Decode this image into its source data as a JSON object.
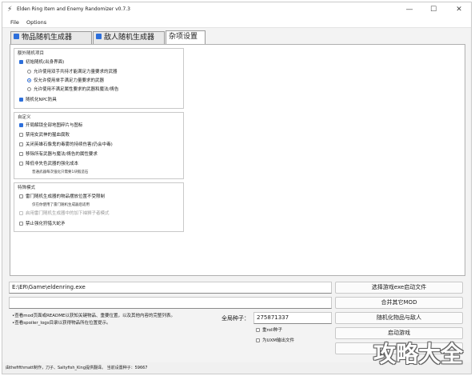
{
  "window": {
    "title": "Elden Ring Item and Enemy Randomizer v0.7.3",
    "minimize": "—",
    "maximize": "☐",
    "close": "✕"
  },
  "menu": {
    "file": "File",
    "options": "Options"
  },
  "tabs": [
    {
      "label": "物品随机生成器",
      "checked": true
    },
    {
      "label": "敌人随机生成器",
      "checked": true
    },
    {
      "label": "杂项设置",
      "active": true
    }
  ],
  "groups": {
    "extra": {
      "title": "额外随机项目",
      "items": [
        {
          "label": "初始随机(出身界面)",
          "type": "checkbox",
          "checked": true
        },
        {
          "label": "允许使用双手共持才能满足力量要求的武器",
          "type": "radio",
          "checked": false
        },
        {
          "label": "仅允许使用单手满足力量要求的武器",
          "type": "radio",
          "checked": true
        },
        {
          "label": "允许使用不满足属性要求的武器和魔法/祷告",
          "type": "radio",
          "checked": false
        },
        {
          "label": "随机化NPC防具",
          "type": "checkbox",
          "checked": true
        }
      ]
    },
    "custom": {
      "title": "自定义",
      "items": [
        {
          "label": "开局解锁全部地图碎片与图标",
          "checked": true
        },
        {
          "label": "禁用女武神的猩血腐败",
          "checked": false
        },
        {
          "label": "关闭英雄石像鬼的毒雾的持续伤害(仍会中毒)",
          "checked": false
        },
        {
          "label": "移除所有武器与魔法/祷告的属性要求",
          "checked": false
        },
        {
          "label": "降低非失色武器的强化成本",
          "checked": false
        }
      ],
      "note": "普通武器每次强化只需要1块锻造石"
    },
    "special": {
      "title": "特殊模式",
      "items": [
        {
          "label": "雷门随机生成器的物品摆放位置不受限制",
          "checked": false,
          "disabled": false
        },
        {
          "label": "启用雷门随机生成器中的加下袖狮子者模式",
          "checked": false,
          "disabled": true
        },
        {
          "label": "禁止强化狩猎大蛇矛",
          "checked": false,
          "disabled": false
        }
      ],
      "note": "仅在你使用了雷门随机生成器后适用"
    }
  },
  "path": {
    "value": "E:\\ER\\Game\\eldenring.exe"
  },
  "buttons": {
    "select_exe": "选择游戏exe启动文件",
    "merge_mod": "合并其它MOD",
    "randomize": "随机化物品与敌人",
    "launch": "启动游戏"
  },
  "info": {
    "line1": "•查看mod页面或README以获知关键物品、重要位置，以及其他内容的完整列表。",
    "line2": "•查看spoiler_logs目录以获得物品所在位置提示。"
  },
  "seed": {
    "label": "全局种子：",
    "value": "275871337",
    "reroll": "重roll种子",
    "uxm": "为UXM输出文件"
  },
  "status": {
    "text": "由thefifthmatt制作，刀子、Saltyfish_King提供翻译。 当前设置种子：59667"
  },
  "watermark": "攻略大全"
}
